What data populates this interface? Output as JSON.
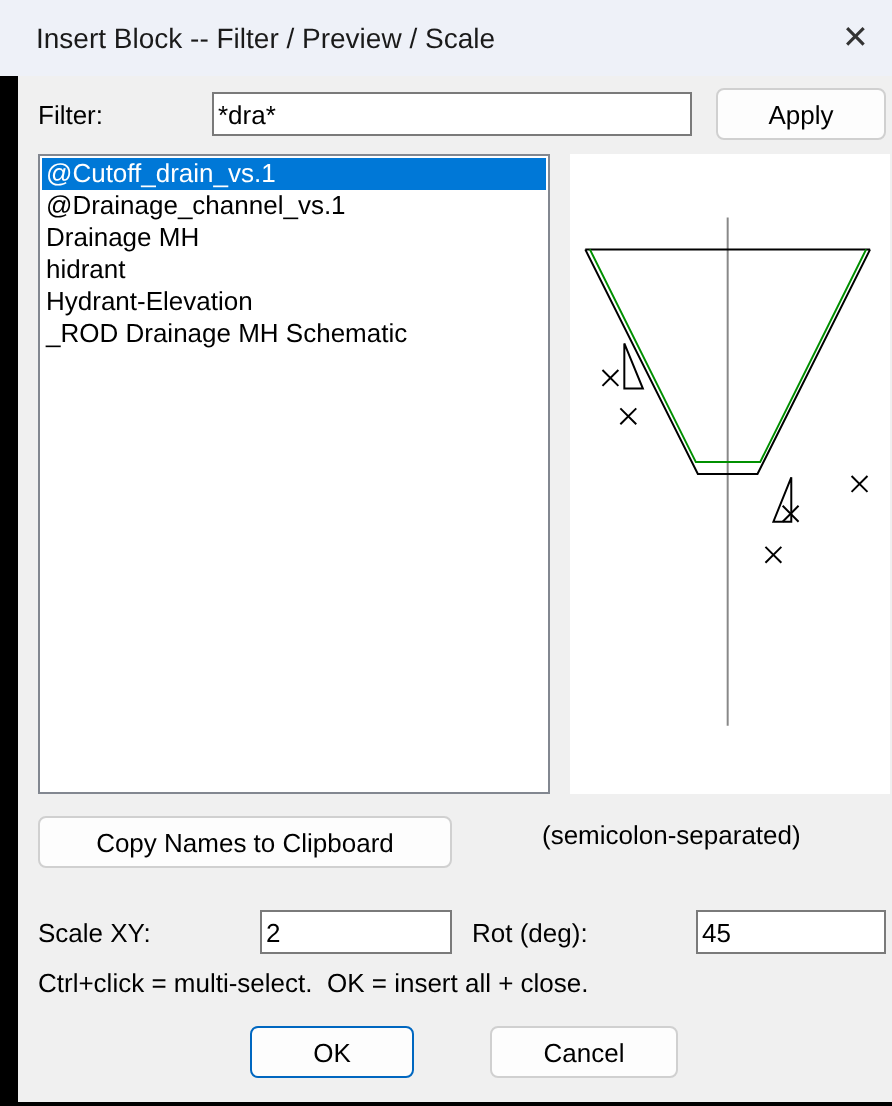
{
  "window": {
    "title": "Insert Block -- Filter / Preview / Scale",
    "close": "✕"
  },
  "filter": {
    "label": "Filter:",
    "value": "*dra*",
    "button": "Apply"
  },
  "blocks": [
    {
      "name": "@Cutoff_drain_vs.1",
      "selected": true
    },
    {
      "name": "@Drainage_channel_vs.1",
      "selected": false
    },
    {
      "name": "Drainage MH",
      "selected": false
    },
    {
      "name": "hidrant",
      "selected": false
    },
    {
      "name": "Hydrant-Elevation",
      "selected": false
    },
    {
      "name": "_ROD Drainage MH Schematic",
      "selected": false
    }
  ],
  "copy": {
    "button": "Copy Names to Clipboard",
    "note": "(semicolon-separated)"
  },
  "scale": {
    "label": "Scale XY:",
    "value": "2"
  },
  "rotation": {
    "label": "Rot (deg):",
    "value": "45"
  },
  "hint": "Ctrl+click = multi-select.  OK = insert all + close.",
  "buttons": [
    {
      "label": "OK",
      "default": true
    },
    {
      "label": "Cancel",
      "default": false
    }
  ]
}
